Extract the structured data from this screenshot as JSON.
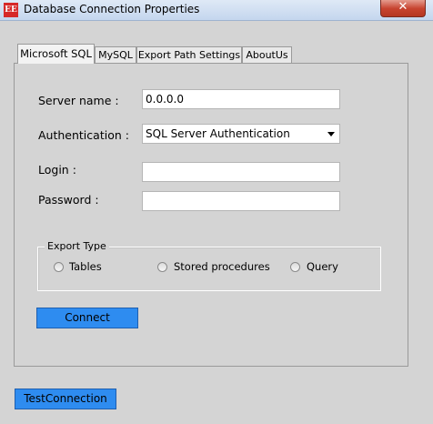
{
  "window": {
    "title": "Database Connection Properties",
    "icon_text": "EE",
    "close_glyph": "✕"
  },
  "tabs": [
    {
      "label": "Microsoft SQL",
      "active": true
    },
    {
      "label": "MySQL",
      "active": false
    },
    {
      "label": "Export Path Settings",
      "active": false
    },
    {
      "label": "AboutUs",
      "active": false
    }
  ],
  "form": {
    "server_name_label": "Server name :",
    "server_name_value": "0.0.0.0",
    "authentication_label": "Authentication :",
    "authentication_value": "SQL Server Authentication",
    "login_label": "Login :",
    "login_value": "",
    "password_label": "Password :",
    "password_value": ""
  },
  "export_type": {
    "legend": "Export Type",
    "options": [
      "Tables",
      "Stored procedures",
      "Query"
    ]
  },
  "buttons": {
    "connect": "Connect",
    "test_connection": "TestConnection"
  },
  "colors": {
    "button_blue": "#2e8cf0",
    "close_red": "#c7432f"
  }
}
